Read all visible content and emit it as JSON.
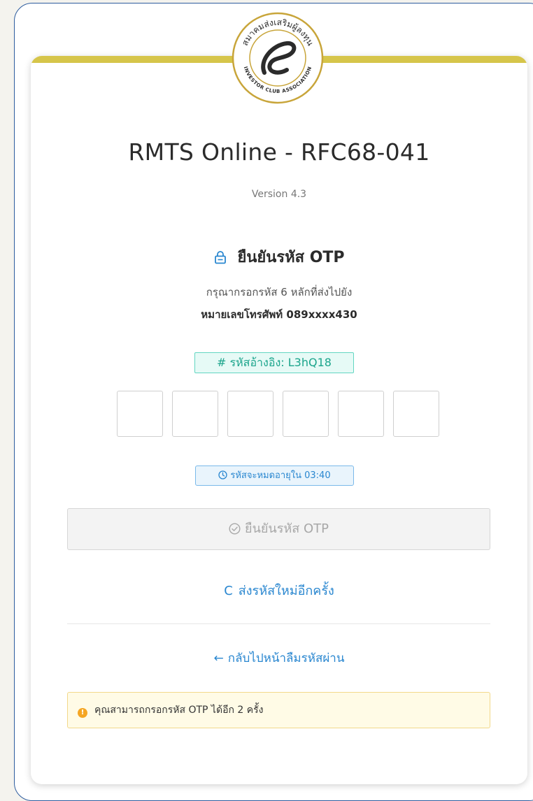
{
  "header": {
    "title": "RMTS Online - RFC68-041",
    "version": "Version 4.3"
  },
  "logo": {
    "text_thai": "สมาคมส่งเสริมผู้ลงทุนไทย",
    "text_en": "INVESTOR CLUB ASSOCIATION",
    "color": "#c8a53a"
  },
  "otp": {
    "heading": "ยืนยันรหัส OTP",
    "instruction": "กรุณากรอกรหัส 6 หลักที่ส่งไปยัง",
    "phone": "หมายเลขโทรศัพท์ 089xxxx430",
    "reference": "# รหัสอ้างอิง: L3hQ18",
    "digits": [
      "",
      "",
      "",
      "",
      "",
      ""
    ],
    "timer": "รหัสจะหมดอายุใน 03:40"
  },
  "actions": {
    "verify_label": "ยืนยันรหัส OTP",
    "resend_label": "ส่งรหัสใหม่อีกครั้ง",
    "back_label": "กลับไปหน้าลืมรหัสผ่าน"
  },
  "warning": {
    "text": "คุณสามารถกรอกรหัส OTP ได้อีก 2 ครั้ง"
  },
  "colors": {
    "accent": "#2a87d0",
    "gold": "#d6c54a",
    "teal": "#1ca58c",
    "warning": "#f5a623"
  }
}
